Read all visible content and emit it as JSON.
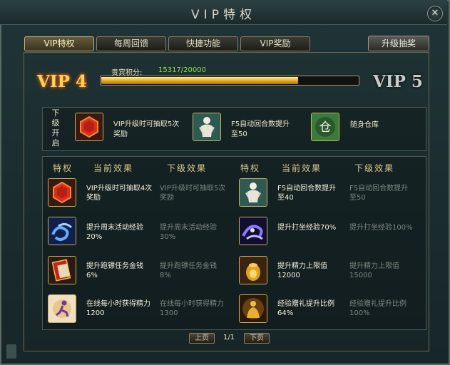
{
  "window": {
    "title": "VIP特权",
    "close_icon": "close-icon"
  },
  "tabs": [
    {
      "label": "VIP特权",
      "active": true
    },
    {
      "label": "每周回馈",
      "active": false
    },
    {
      "label": "快捷功能",
      "active": false
    },
    {
      "label": "VIP奖励",
      "active": false
    }
  ],
  "lottery_button": "升级抽奖",
  "vip": {
    "current": "VIP 4",
    "next": "VIP 5",
    "points_label": "贵宾积分:",
    "points_text": "15317/20000",
    "progress_fraction": 0.76585,
    "colors": {
      "current": "#f5d65a",
      "points": "#7fe64d",
      "bar": "#e0a91e"
    }
  },
  "next_unlock": {
    "label": "下级开启",
    "items": [
      {
        "icon": "hexagon-chest-icon",
        "text": "VIP升级时可抽取5次奖励"
      },
      {
        "icon": "hero-figure-icon",
        "text": "F5自动回合数提升至50"
      },
      {
        "icon": "storage-warehouse-icon",
        "text": "随身仓库"
      }
    ]
  },
  "table": {
    "headers": [
      "特权",
      "当前效果",
      "下级效果",
      "特权",
      "当前效果",
      "下级效果"
    ],
    "left": [
      {
        "icon": "hexagon-chest-icon",
        "current": "VIP升级时可抽取4次奖励",
        "next": "VIP升级时可抽取5次奖励"
      },
      {
        "icon": "blue-swirl-icon",
        "current": "提升周末活动经验20%",
        "next": "提升周末活动经验30%"
      },
      {
        "icon": "red-scroll-icon",
        "current": "提升跑镖任务金钱6%",
        "next": "提升跑镖任务金钱8%"
      },
      {
        "icon": "energy-figure-icon",
        "current": "在线每小时获得精力1200",
        "next": "在线每小时获得精力1300"
      }
    ],
    "right": [
      {
        "icon": "hero-figure-icon",
        "current": "F5自动回合数提升至40",
        "next": "F5自动回合数提升至50"
      },
      {
        "icon": "meditation-swirl-icon",
        "current": "提升打坐经验70%",
        "next": "提升打坐经验100%"
      },
      {
        "icon": "golden-vessel-icon",
        "current": "提升精力上限值12000",
        "next": "提升精力上限值15000"
      },
      {
        "icon": "golden-buddha-icon",
        "current": "经验赠礼提升比例64%",
        "next": "经验赠礼提升比例100%"
      }
    ]
  },
  "pagination": {
    "prev": "上页",
    "page": "1/1",
    "next": "下页"
  }
}
